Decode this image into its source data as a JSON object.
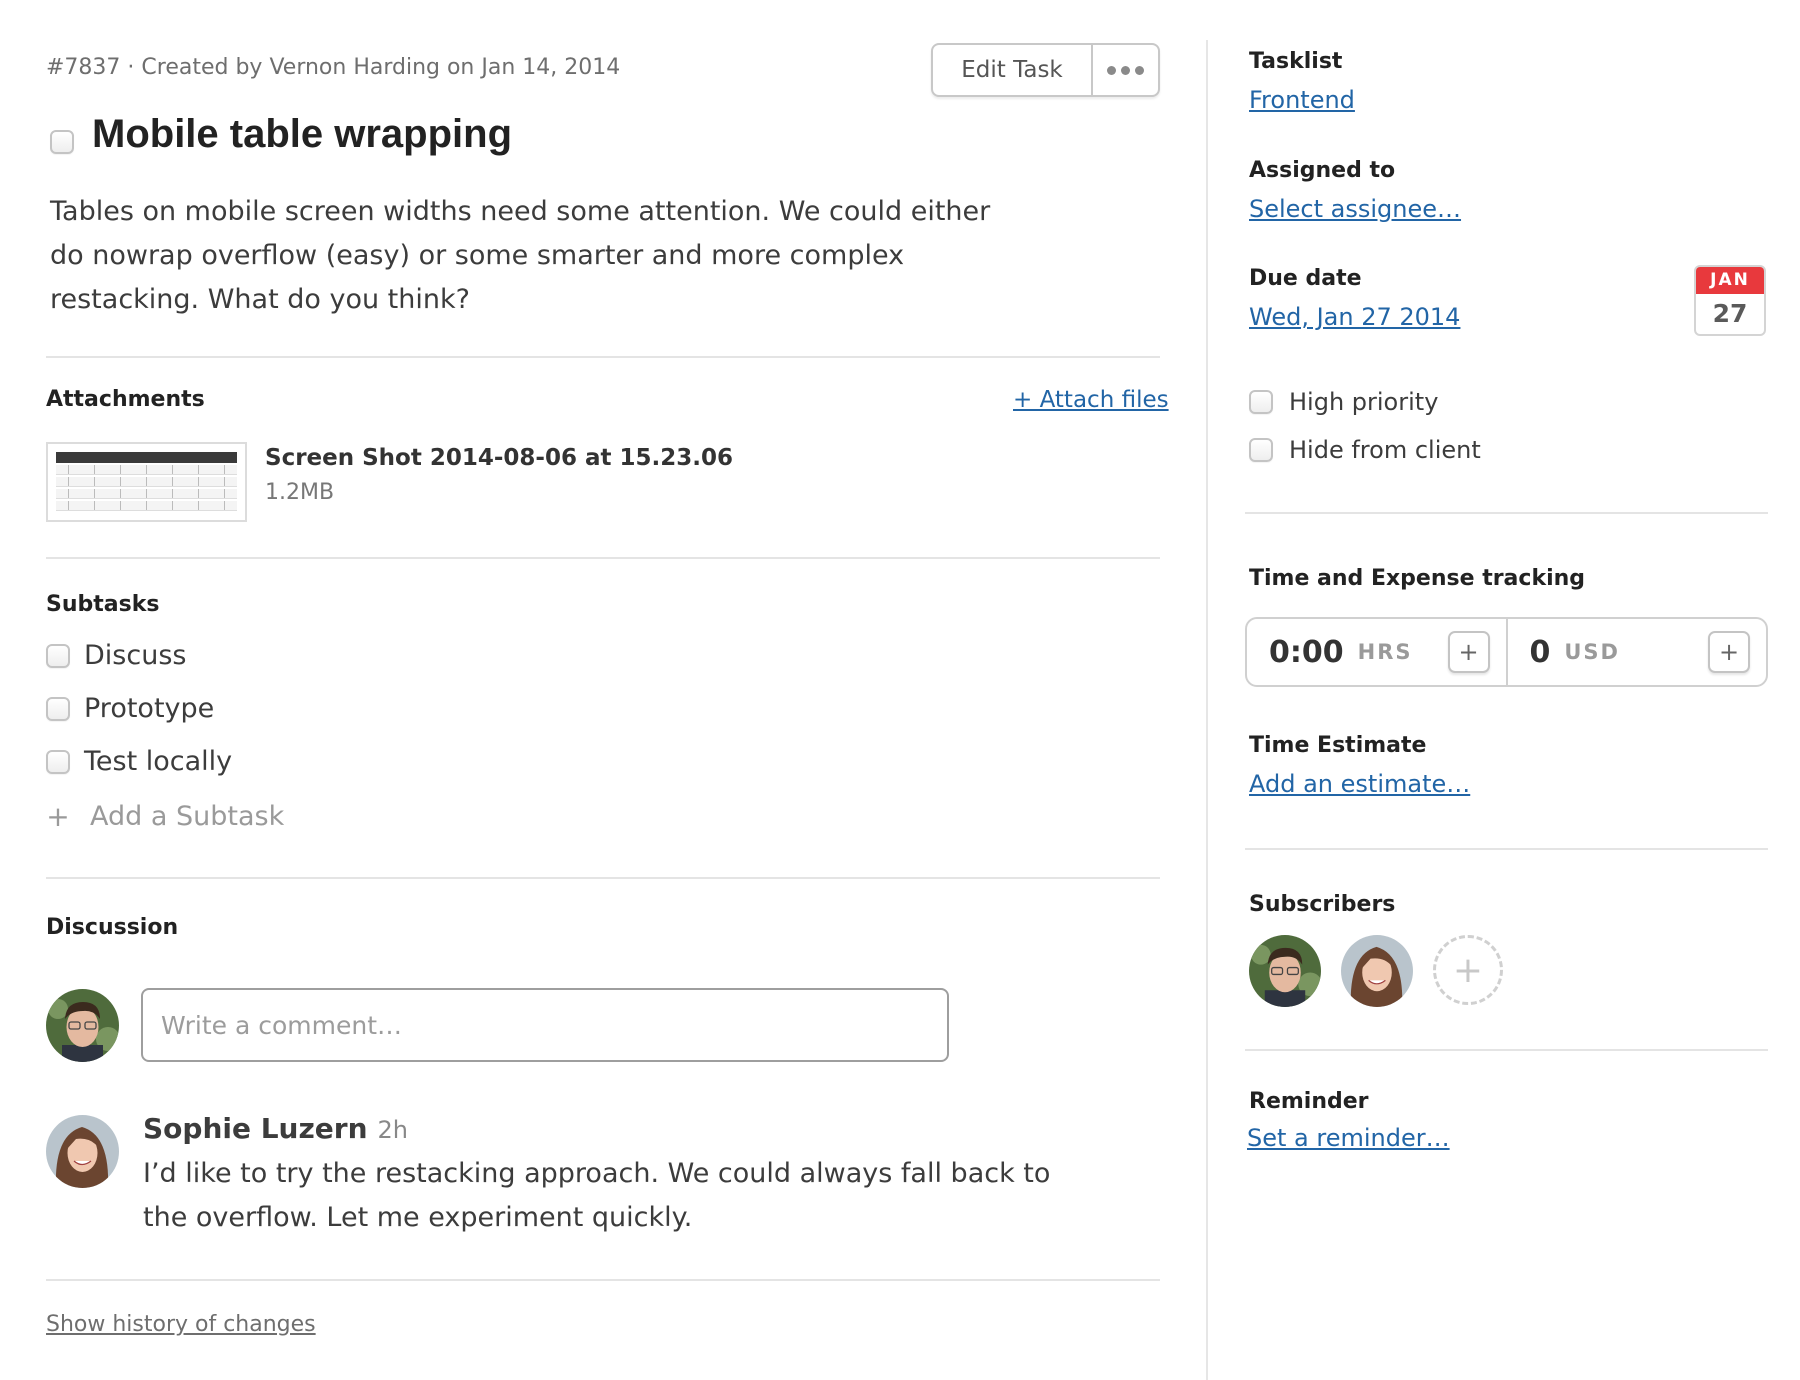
{
  "header": {
    "meta": "#7837 · Created by Vernon Harding on Jan 14, 2014",
    "edit_label": "Edit Task",
    "more_icon": "ellipsis-icon"
  },
  "task": {
    "title": "Mobile table wrapping",
    "completed": false,
    "description": "Tables on mobile screen widths need some attention. We could either do nowrap overflow (easy) or some smarter and more complex restacking. What do you think?"
  },
  "attachments": {
    "heading": "Attachments",
    "attach_label": "+ Attach files",
    "files": [
      {
        "name": "Screen Shot 2014-08-06 at 15.23.06",
        "size": "1.2MB"
      }
    ]
  },
  "subtasks": {
    "heading": "Subtasks",
    "items": [
      {
        "label": "Discuss",
        "done": false
      },
      {
        "label": "Prototype",
        "done": false
      },
      {
        "label": "Test locally",
        "done": false
      }
    ],
    "add_label": "Add a Subtask"
  },
  "discussion": {
    "heading": "Discussion",
    "comment_placeholder": "Write a comment…",
    "comments": [
      {
        "author": "Sophie Luzern",
        "time": "2h",
        "text": "I’d like to try the restacking approach. We could always fall back to the overflow. Let me experiment quickly."
      }
    ],
    "history_label": "Show history of changes"
  },
  "sidebar": {
    "tasklist": {
      "label": "Tasklist",
      "value": "Frontend"
    },
    "assigned": {
      "label": "Assigned to",
      "value": "Select assignee…"
    },
    "due": {
      "label": "Due date",
      "value": "Wed, Jan 27 2014",
      "cal_month": "JAN",
      "cal_day": "27"
    },
    "options": [
      {
        "label": "High priority",
        "checked": false
      },
      {
        "label": "Hide from client",
        "checked": false
      }
    ],
    "tracking": {
      "label": "Time and Expense tracking",
      "time_value": "0:00",
      "time_unit": "HRS",
      "expense_value": "0",
      "expense_unit": "USD"
    },
    "estimate": {
      "label": "Time Estimate",
      "value": "Add an estimate…"
    },
    "subscribers": {
      "label": "Subscribers",
      "people": [
        "Vernon Harding",
        "Sophie Luzern"
      ]
    },
    "reminder": {
      "label": "Reminder",
      "value": "Set a reminder…"
    }
  },
  "colors": {
    "link": "#2265a6",
    "calendar_red": "#e8393d"
  }
}
